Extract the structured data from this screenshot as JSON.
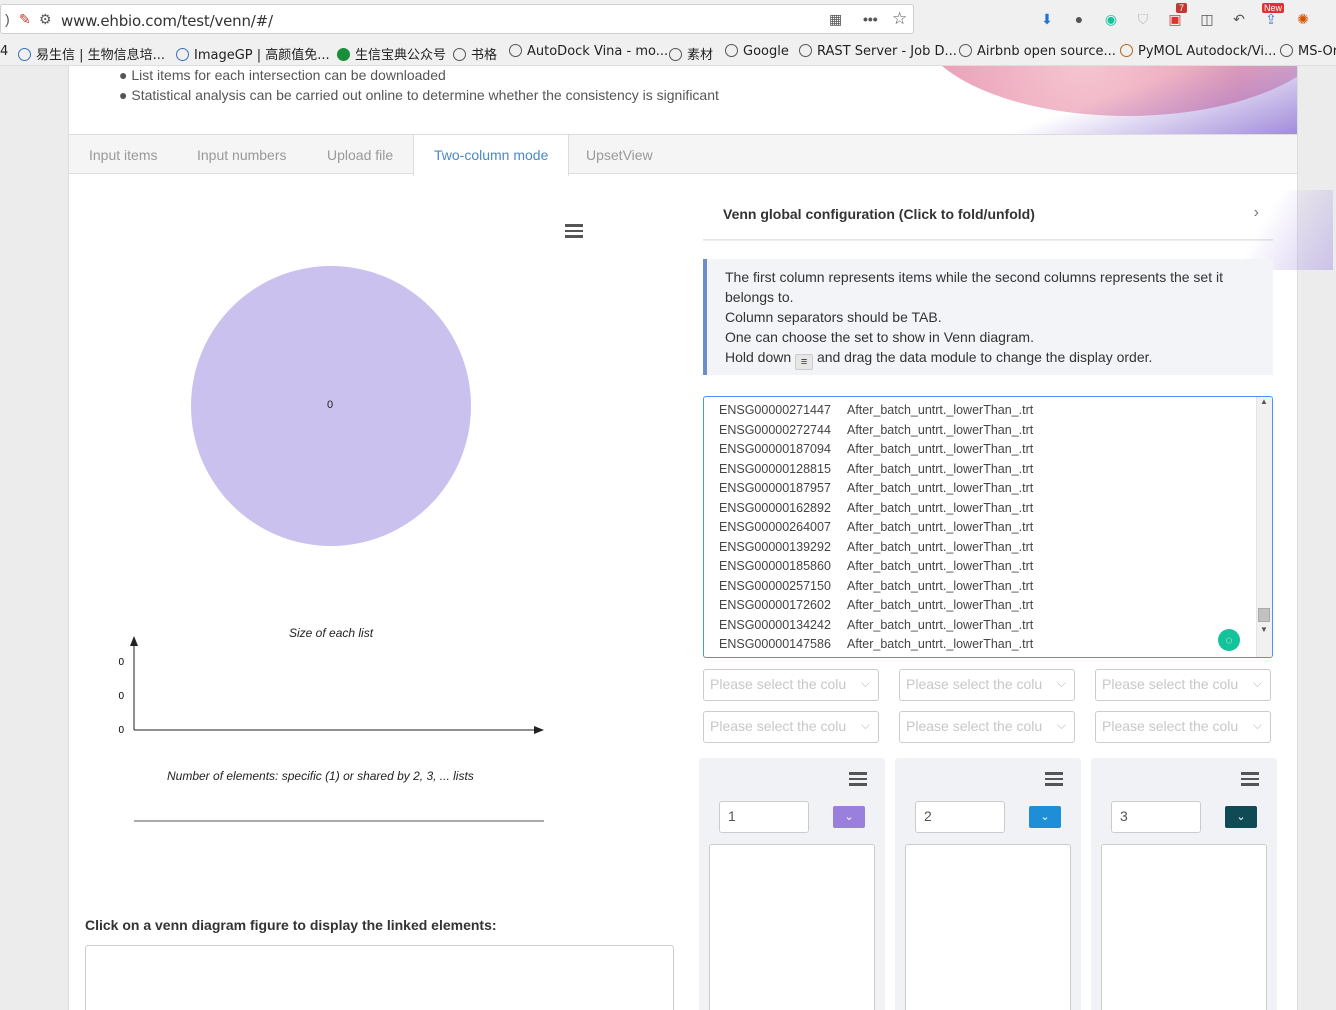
{
  "browser": {
    "url": "www.ehbio.com/test/venn/#/",
    "bookmarks": [
      "易生信 | 生物信息培...",
      "ImageGP | 高颜值免...",
      "生信宝典公众号",
      "书格",
      "AutoDock Vina - mo...",
      "素材",
      "Google",
      "RAST Server - Job D...",
      "Airbnb open source...",
      "PyMOL Autodock/Vi...",
      "MS-Or"
    ],
    "badge_count": "7",
    "badge_new": "New"
  },
  "hero": {
    "bullets": [
      "List items for each intersection can be downloaded",
      "Statistical analysis can be carried out online to determine whether the consistency is significant"
    ]
  },
  "tabs": [
    "Input items",
    "Input numbers",
    "Upload file",
    "Two-column mode",
    "UpsetView"
  ],
  "active_tab": "Two-column mode",
  "venn": {
    "center_value": "0",
    "color": "#cbc1ee"
  },
  "size_chart": {
    "title": "Size of each list",
    "yticks": [
      "0",
      "0",
      "0"
    ],
    "xlabel": "Number of elements: specific (1) or shared by 2, 3, ... lists"
  },
  "config": {
    "title": "Venn global configuration (Click to fold/unfold)"
  },
  "info": {
    "line1": "The first column represents items while the second columns represents the set it belongs to.",
    "line2": "Column separators should be TAB.",
    "line3": "One can choose the set to show in Venn diagram.",
    "line4a": "Hold down",
    "line4b": "and drag the data module to change the display order."
  },
  "textarea_rows": [
    [
      "ENSG00000271447",
      "After_batch_untrt._lowerThan_.trt"
    ],
    [
      "ENSG00000272744",
      "After_batch_untrt._lowerThan_.trt"
    ],
    [
      "ENSG00000187094",
      "After_batch_untrt._lowerThan_.trt"
    ],
    [
      "ENSG00000128815",
      "After_batch_untrt._lowerThan_.trt"
    ],
    [
      "ENSG00000187957",
      "After_batch_untrt._lowerThan_.trt"
    ],
    [
      "ENSG00000162892",
      "After_batch_untrt._lowerThan_.trt"
    ],
    [
      "ENSG00000264007",
      "After_batch_untrt._lowerThan_.trt"
    ],
    [
      "ENSG00000139292",
      "After_batch_untrt._lowerThan_.trt"
    ],
    [
      "ENSG00000185860",
      "After_batch_untrt._lowerThan_.trt"
    ],
    [
      "ENSG00000257150",
      "After_batch_untrt._lowerThan_.trt"
    ],
    [
      "ENSG00000172602",
      "After_batch_untrt._lowerThan_.trt"
    ],
    [
      "ENSG00000134242",
      "After_batch_untrt._lowerThan_.trt"
    ],
    [
      "ENSG00000147586",
      "After_batch_untrt._lowerThan_.trt"
    ]
  ],
  "select_placeholder": "Please select the colu",
  "panels": [
    {
      "name": "1",
      "color": "#9b7fdc"
    },
    {
      "name": "2",
      "color": "#1e8fd6"
    },
    {
      "name": "3",
      "color": "#0f4a55"
    }
  ],
  "click_title": "Click on a venn diagram figure to display the linked elements:"
}
